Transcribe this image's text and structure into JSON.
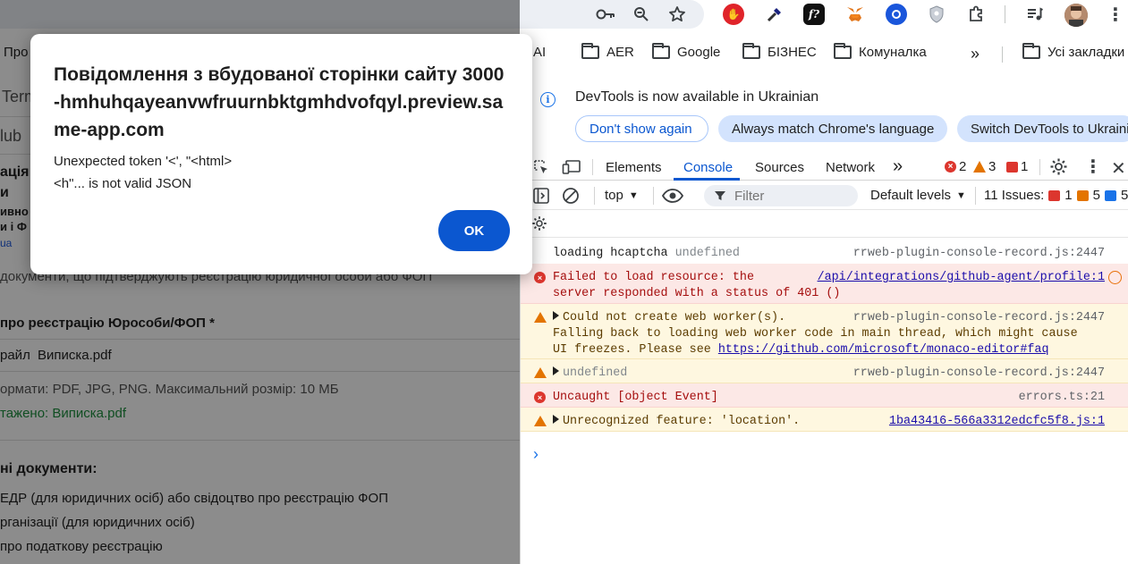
{
  "toolbar": {
    "icons": [
      "key-icon",
      "zoom-icon",
      "star-icon",
      "opera-icon",
      "eyedropper-icon",
      "font-icon",
      "metamask-icon",
      "circle-ext-icon",
      "shield-ext-icon",
      "puzzle-icon",
      "media-icon",
      "avatar",
      "menu-icon"
    ]
  },
  "bookmarks": {
    "partial_left": "Про",
    "items": [
      "AI",
      "AER",
      "Google",
      "БІЗНЕС",
      "Комуналка"
    ],
    "more": "»",
    "all_bookmarks": "Усі закладки"
  },
  "page": {
    "tab1": "Term",
    "tab2": "lub",
    "heading1": "ація",
    "heading2": "и",
    "line3": "ивно",
    "line4": "и і Ф",
    "line5": "ua",
    "desc": "документи, що підтверджують реєстрацію юридичної особи або ФОП",
    "label": "про реєстрацію Юрособи/ФОП *",
    "file_btn": "райл",
    "file_name": "Виписка.pdf",
    "formats": "ормати: PDF, JPG, PNG. Максимальний розмір: 10 МБ",
    "uploaded": "тажено: Виписка.pdf",
    "docs_heading": "ні документи:",
    "doc1": "ЕДР (для юридичних осіб) або свідоцтво про реєстрацію ФОП",
    "doc2": "рганізації (для юридичних осіб)",
    "doc3": " про податкову реєстрацію"
  },
  "dialog": {
    "title": "Повідомлення з вбудованої сторінки сайту 3000-hmhuhqayeanvwfruurnbktgmhdvofqyl.preview.same-app.com",
    "message": "Unexpected token '<', \"<html>\n<h\"... is not valid JSON",
    "ok": "OK"
  },
  "devtools": {
    "info": {
      "text": "DevTools is now available in Ukrainian",
      "dont_show": "Don't show again",
      "always_match": "Always match Chrome's language",
      "switch": "Switch DevTools to Ukrainian"
    },
    "tabs": [
      "Elements",
      "Console",
      "Sources",
      "Network"
    ],
    "more_tabs": "»",
    "counts": {
      "errors": "2",
      "warnings": "3",
      "issues_err": "1"
    },
    "filter": {
      "context": "top",
      "placeholder": "Filter",
      "levels": "Default levels",
      "issues_label": "11 Issues:",
      "issues_err": "1",
      "issues_warn": "5",
      "issues_info": "5"
    },
    "messages": [
      {
        "level": "info",
        "text": "loading hcaptcha",
        "extra": "undefined",
        "source": "rrweb-plugin-console-record.js:2447"
      },
      {
        "level": "error",
        "text": "Failed to load resource: the",
        "text2": "server responded with a status of 401 ()",
        "source": "/api/integrations/github-agent/profile:1"
      },
      {
        "level": "warn",
        "text": "Could not create web worker(s).",
        "text2": "Falling back to loading web worker code in main thread, which might cause",
        "text3": "UI freezes. Please see",
        "link": "https://github.com/microsoft/monaco-editor#faq",
        "source": "rrweb-plugin-console-record.js:2447"
      },
      {
        "level": "warn",
        "text": "undefined",
        "source": "rrweb-plugin-console-record.js:2447"
      },
      {
        "level": "error",
        "text": "Uncaught [object Event]",
        "source": "errors.ts:21"
      },
      {
        "level": "warn",
        "text": "Unrecognized feature: 'location'.",
        "source": "1ba43416-566a3312edcfc5f8.js:1"
      }
    ],
    "prompt": "›"
  }
}
